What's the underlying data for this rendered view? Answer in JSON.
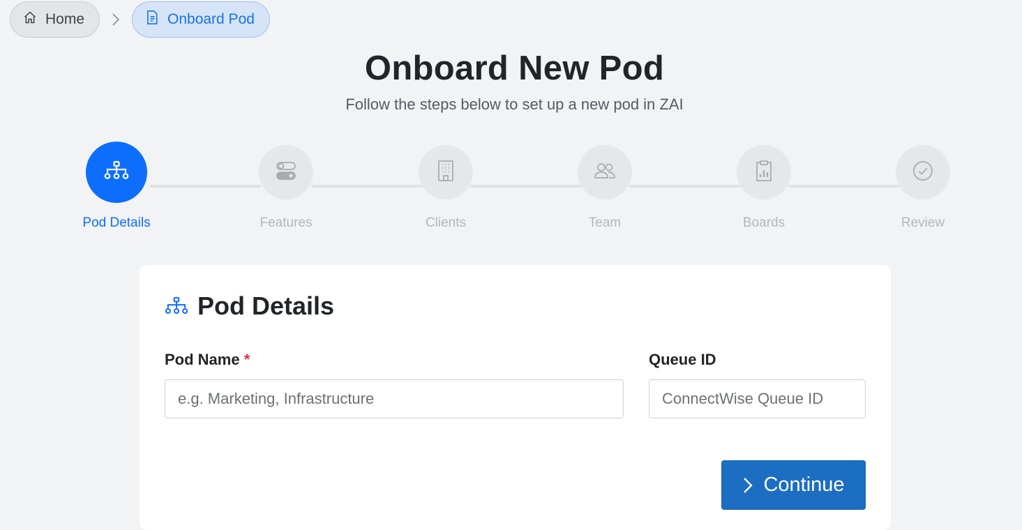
{
  "breadcrumb": {
    "home_label": "Home",
    "current_label": "Onboard Pod"
  },
  "page": {
    "title": "Onboard New Pod",
    "subtitle": "Follow the steps below to set up a new pod in ZAI"
  },
  "stepper": {
    "steps": [
      {
        "label": "Pod Details",
        "icon": "sitemap-icon",
        "state": "active"
      },
      {
        "label": "Features",
        "icon": "toggles-icon",
        "state": "upcoming"
      },
      {
        "label": "Clients",
        "icon": "building-icon",
        "state": "upcoming"
      },
      {
        "label": "Team",
        "icon": "people-icon",
        "state": "upcoming"
      },
      {
        "label": "Boards",
        "icon": "clipboard-data-icon",
        "state": "upcoming"
      },
      {
        "label": "Review",
        "icon": "check-circle-icon",
        "state": "upcoming"
      }
    ]
  },
  "card": {
    "title": "Pod Details",
    "pod_name": {
      "label": "Pod Name",
      "required_mark": "*",
      "placeholder": "e.g. Marketing, Infrastructure",
      "value": ""
    },
    "queue_id": {
      "label": "Queue ID",
      "placeholder": "ConnectWise Queue ID",
      "value": ""
    },
    "continue_label": "Continue"
  },
  "colors": {
    "accent": "#0d6efd",
    "button": "#1b6ec2",
    "background": "#f2f3f5",
    "required": "#dc3545"
  }
}
